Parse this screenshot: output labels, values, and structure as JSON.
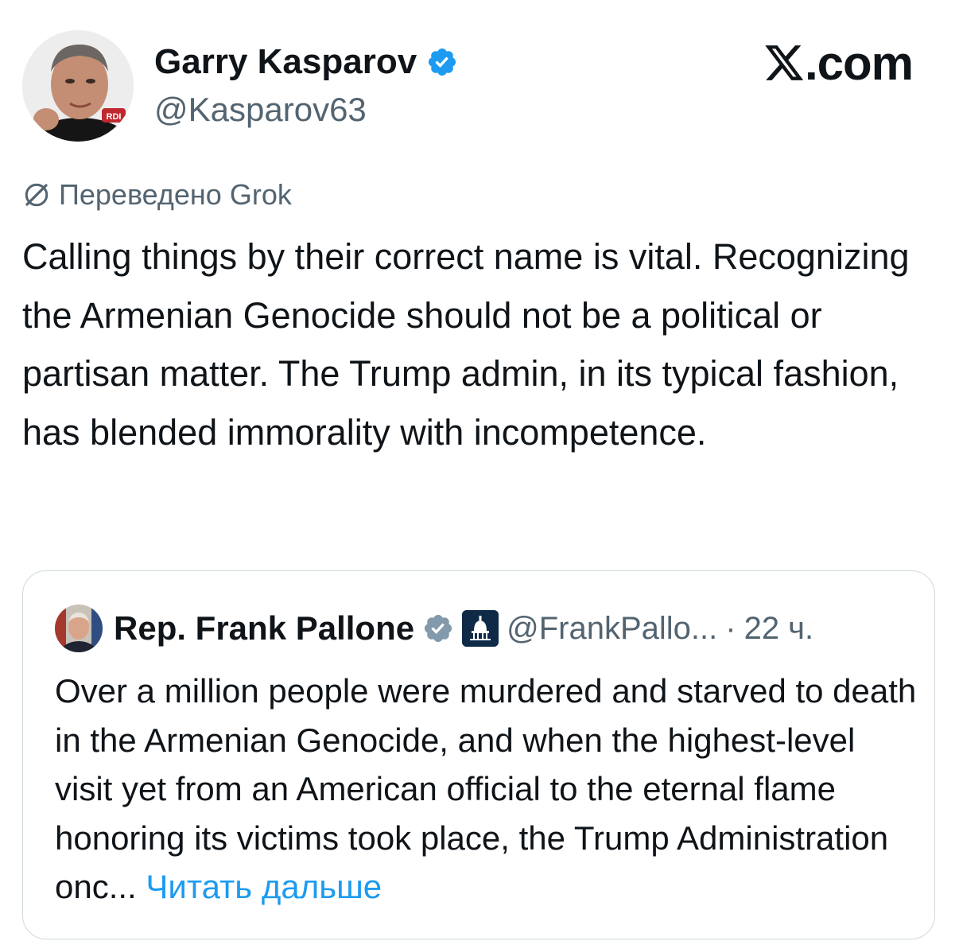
{
  "author": {
    "name": "Garry Kasparov",
    "handle": "@Kasparov63",
    "verified": true,
    "avatar_badge": "RDI"
  },
  "brand": {
    "label": ".com",
    "logo": "x-logo-icon"
  },
  "translation": {
    "label": "Переведено Grok",
    "icon": "grok-icon"
  },
  "tweet": {
    "text": "Calling things by their correct name is vital. Recognizing the Armenian Genocide should not be a political or partisan matter. The Trump admin, in its typical fashion, has blended immorality with incompetence."
  },
  "quote": {
    "name": "Rep. Frank Pallone",
    "handle": "@FrankPallo...",
    "separator": "·",
    "time": "22 ч.",
    "verified_color": "#829aab",
    "text": "Over a million people were murdered and starved to death in the Armenian Genocide, and when the highest-level visit yet from an American official to the eternal flame honoring its victims took place, the Trump Administration onc...",
    "read_more": "Читать дальше"
  },
  "colors": {
    "text": "#0f1419",
    "secondary": "#536471",
    "link": "#1d9bf0",
    "verified_blue": "#1d9bf0",
    "border": "#cfd9de"
  }
}
